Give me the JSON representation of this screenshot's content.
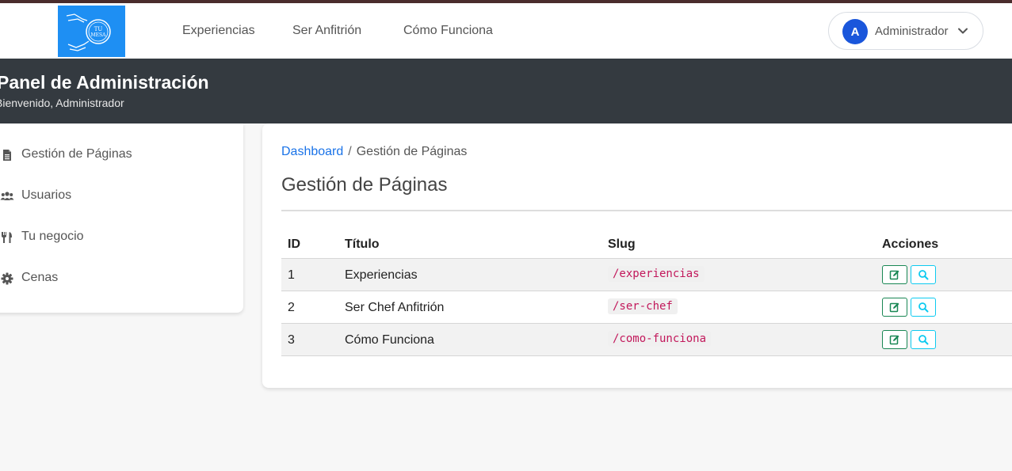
{
  "brand": {
    "logo_text_line1": "TU",
    "logo_text_line2": "MESA",
    "color": "#1e8ff3"
  },
  "nav": {
    "links": [
      {
        "label": "Experiencias"
      },
      {
        "label": "Ser Anfitrión"
      },
      {
        "label": "Cómo Funciona"
      }
    ]
  },
  "user": {
    "avatar_letter": "A",
    "name": "Administrador",
    "avatar_color": "#1a56db"
  },
  "banner": {
    "title": "Panel de Administración",
    "subtitle": "Bienvenido, Administrador"
  },
  "sidebar": {
    "items": [
      {
        "label": "Gestión de Páginas",
        "icon": "file-icon"
      },
      {
        "label": "Usuarios",
        "icon": "users-icon"
      },
      {
        "label": "Tu negocio",
        "icon": "utensils-icon"
      },
      {
        "label": "Cenas",
        "icon": "gear-icon"
      }
    ]
  },
  "breadcrumb": {
    "home": "Dashboard",
    "separator": "/",
    "current": "Gestión de Páginas"
  },
  "page": {
    "title": "Gestión de Páginas"
  },
  "table": {
    "headers": {
      "id": "ID",
      "title": "Título",
      "slug": "Slug",
      "actions": "Acciones"
    },
    "rows": [
      {
        "id": "1",
        "title": "Experiencias",
        "slug": "/experiencias"
      },
      {
        "id": "2",
        "title": "Ser Chef Anfitrión",
        "slug": "/ser-chef"
      },
      {
        "id": "3",
        "title": "Cómo Funciona",
        "slug": "/como-funciona"
      }
    ]
  },
  "colors": {
    "banner_bg": "#343a40",
    "edit_button": "#198754",
    "view_button": "#0dcaf0",
    "slug_text": "#c2185b",
    "link": "#1a73e8"
  }
}
